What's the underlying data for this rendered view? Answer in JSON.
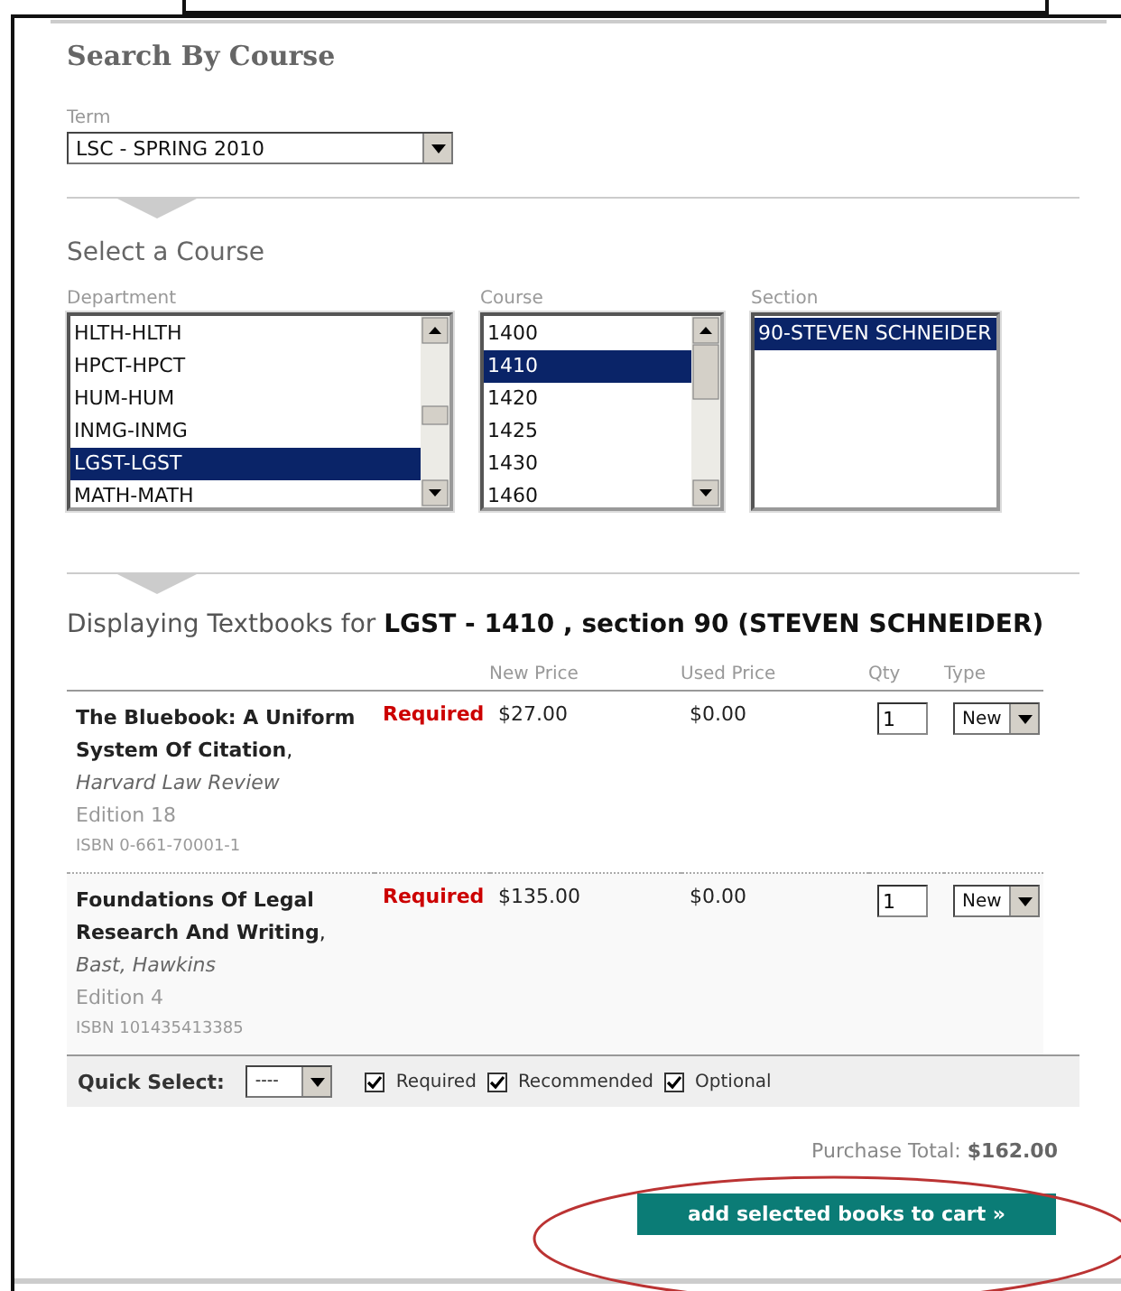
{
  "heading": "Search By Course",
  "term": {
    "label": "Term",
    "value": "LSC - SPRING 2010"
  },
  "course_picker": {
    "heading": "Select a Course",
    "lists": [
      {
        "label": "Department",
        "kind": "scroll",
        "items": [
          {
            "text": "HLTH-HLTH",
            "selected": false
          },
          {
            "text": "HPCT-HPCT",
            "selected": false
          },
          {
            "text": "HUM-HUM",
            "selected": false
          },
          {
            "text": "INMG-INMG",
            "selected": false
          },
          {
            "text": "LGST-LGST",
            "selected": true
          },
          {
            "text": "MATH-MATH",
            "selected": false
          }
        ]
      },
      {
        "label": "Course",
        "kind": "scroll",
        "items": [
          {
            "text": "1400",
            "selected": false
          },
          {
            "text": "1410",
            "selected": true
          },
          {
            "text": "1420",
            "selected": false
          },
          {
            "text": "1425",
            "selected": false
          },
          {
            "text": "1430",
            "selected": false
          },
          {
            "text": "1460",
            "selected": false
          }
        ]
      },
      {
        "label": "Section",
        "kind": "plain",
        "items": [
          {
            "text": "90-STEVEN SCHNEIDER",
            "selected": true
          }
        ]
      }
    ]
  },
  "textbooks": {
    "heading": "Displaying Textbooks for **LGST - 1410 , section 90 (STEVEN SCHNEIDER)**",
    "columns": [
      "New Price",
      "Used Price",
      "Qty",
      "Type"
    ],
    "books": [
      {
        "title": "**The Bluebook: A Uniform System Of Citation**, *Harvard Law Review*",
        "edition": "Edition 18",
        "isbn": "ISBN 0-661-70001-1",
        "status": "Required",
        "new_price": "$27.00",
        "used_price": "$0.00",
        "qty": "1",
        "type": "New"
      },
      {
        "title": "**Foundations Of Legal Research And Writing**, *Bast, Hawkins*",
        "edition": "Edition 4",
        "isbn": "ISBN 101435413385",
        "status": "Required",
        "new_price": "$135.00",
        "used_price": "$0.00",
        "qty": "1",
        "type": "New"
      }
    ]
  },
  "quick_select": {
    "label": "Quick Select:",
    "value": "----",
    "filters": [
      {
        "label": "Required",
        "checked": true
      },
      {
        "label": "Recommended",
        "checked": true
      },
      {
        "label": "Optional",
        "checked": true
      }
    ]
  },
  "total": {
    "label": "Purchase Total:",
    "value": "$162.00"
  },
  "cart_button": "add selected books to cart »"
}
